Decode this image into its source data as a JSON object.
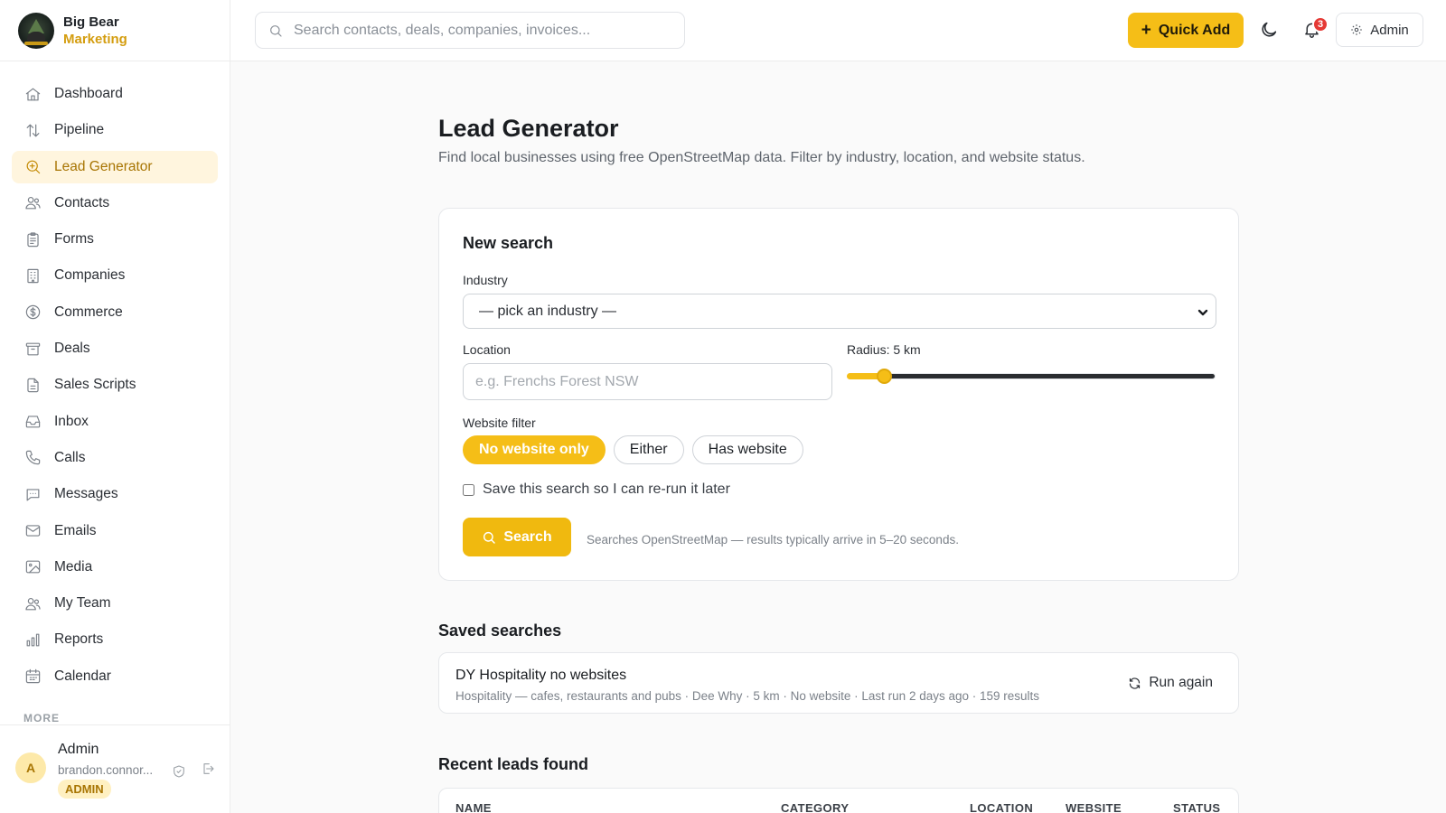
{
  "brand": {
    "name_line1": "Big Bear",
    "name_line2": "Marketing"
  },
  "search": {
    "placeholder": "Search contacts, deals, companies, invoices..."
  },
  "topbar": {
    "quick_add_label": "Quick Add",
    "notification_count": "3",
    "admin_label": "Admin"
  },
  "sidebar": {
    "items": [
      {
        "label": "Dashboard",
        "icon": "home-icon",
        "active": false
      },
      {
        "label": "Pipeline",
        "icon": "arrows-updown-icon",
        "active": false
      },
      {
        "label": "Lead Generator",
        "icon": "search-plus-icon",
        "active": true
      },
      {
        "label": "Contacts",
        "icon": "users-icon",
        "active": false
      },
      {
        "label": "Forms",
        "icon": "clipboard-icon",
        "active": false
      },
      {
        "label": "Companies",
        "icon": "building-icon",
        "active": false
      },
      {
        "label": "Commerce",
        "icon": "dollar-circle-icon",
        "active": false
      },
      {
        "label": "Deals",
        "icon": "archive-icon",
        "active": false
      },
      {
        "label": "Sales Scripts",
        "icon": "file-text-icon",
        "active": false
      },
      {
        "label": "Inbox",
        "icon": "inbox-icon",
        "active": false
      },
      {
        "label": "Calls",
        "icon": "phone-icon",
        "active": false
      },
      {
        "label": "Messages",
        "icon": "message-icon",
        "active": false
      },
      {
        "label": "Emails",
        "icon": "mail-icon",
        "active": false
      },
      {
        "label": "Media",
        "icon": "image-icon",
        "active": false
      },
      {
        "label": "My Team",
        "icon": "team-icon",
        "active": false
      },
      {
        "label": "Reports",
        "icon": "bar-chart-icon",
        "active": false
      },
      {
        "label": "Calendar",
        "icon": "calendar-icon",
        "active": false
      }
    ],
    "more_label": "MORE"
  },
  "user": {
    "initial": "A",
    "name": "Admin",
    "email": "brandon.connor...",
    "role": "ADMIN"
  },
  "page": {
    "title": "Lead Generator",
    "subtitle": "Find local businesses using free OpenStreetMap data. Filter by industry, location, and website status."
  },
  "new_search": {
    "title": "New search",
    "industry_label": "Industry",
    "industry_value": "— pick an industry —",
    "location_label": "Location",
    "location_placeholder": "e.g. Frenchs Forest NSW",
    "radius_label": "Radius: 5 km",
    "radius_fraction": 0.1,
    "website_filter_label": "Website filter",
    "website_options": [
      "No website only",
      "Either",
      "Has website"
    ],
    "website_selected": "No website only",
    "save_label": "Save this search so I can re-run it later",
    "save_checked": false,
    "search_button": "Search",
    "hint": "Searches OpenStreetMap — results typically arrive in 5–20 seconds."
  },
  "saved_searches": {
    "title": "Saved searches",
    "items": [
      {
        "name": "DY Hospitality no websites",
        "meta": "Hospitality — cafes, restaurants and pubs · Dee Why · 5 km · No website · Last run 2 days ago · 159 results",
        "action": "Run again"
      }
    ]
  },
  "recent_leads": {
    "title": "Recent leads found",
    "columns": [
      "NAME",
      "CATEGORY",
      "LOCATION",
      "WEBSITE",
      "STATUS"
    ]
  },
  "colors": {
    "accent": "#f5be17",
    "accent_text": "#a87503",
    "notification": "#e53935"
  }
}
